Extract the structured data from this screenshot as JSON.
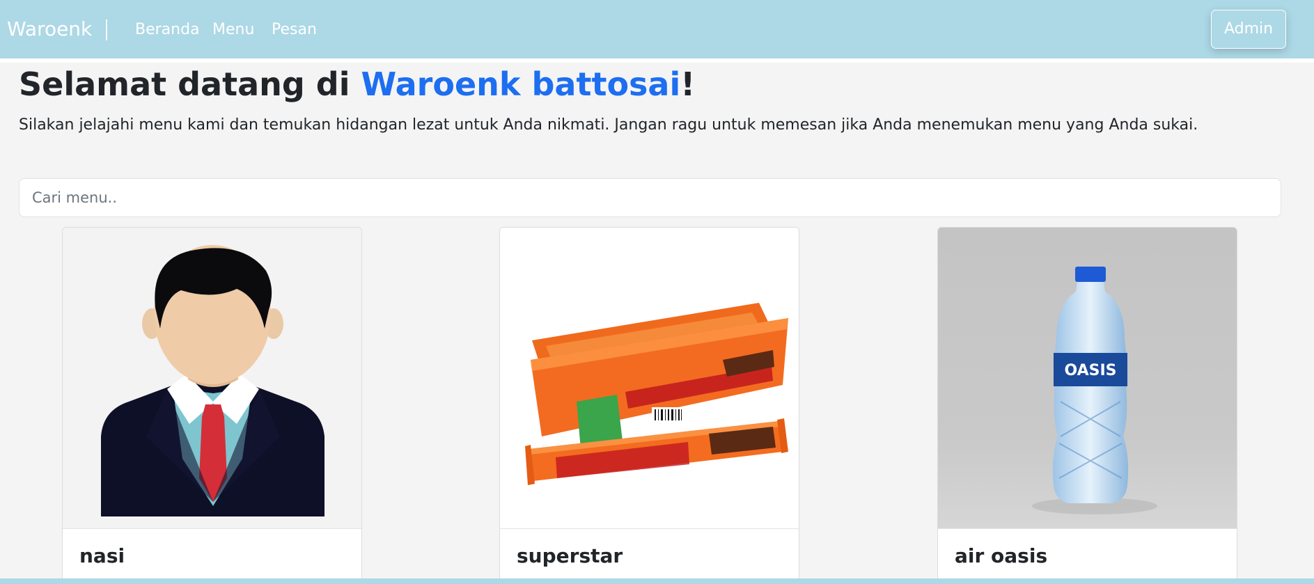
{
  "navbar": {
    "brand": "Waroenk",
    "links": [
      "Beranda",
      "Menu",
      "Pesan"
    ],
    "admin_label": "Admin"
  },
  "hero": {
    "title_prefix": "Selamat datang di ",
    "title_accent": "Waroenk battosai",
    "title_suffix": "!",
    "subtitle": "Silakan jelajahi menu kami dan temukan hidangan lezat untuk Anda nikmati. Jangan ragu untuk memesan jika Anda menemukan menu yang Anda sukai."
  },
  "search": {
    "placeholder": "Cari menu..",
    "value": ""
  },
  "menu_items": [
    {
      "name": "nasi",
      "image": "person-avatar-illustration"
    },
    {
      "name": "superstar",
      "image": "superstar-chocolate-box-photo"
    },
    {
      "name": "air oasis",
      "image": "oasis-water-bottle-photo"
    }
  ],
  "colors": {
    "navbar_bg": "#add8e6",
    "accent": "#1d6ef0",
    "page_bg": "#f4f4f4"
  }
}
